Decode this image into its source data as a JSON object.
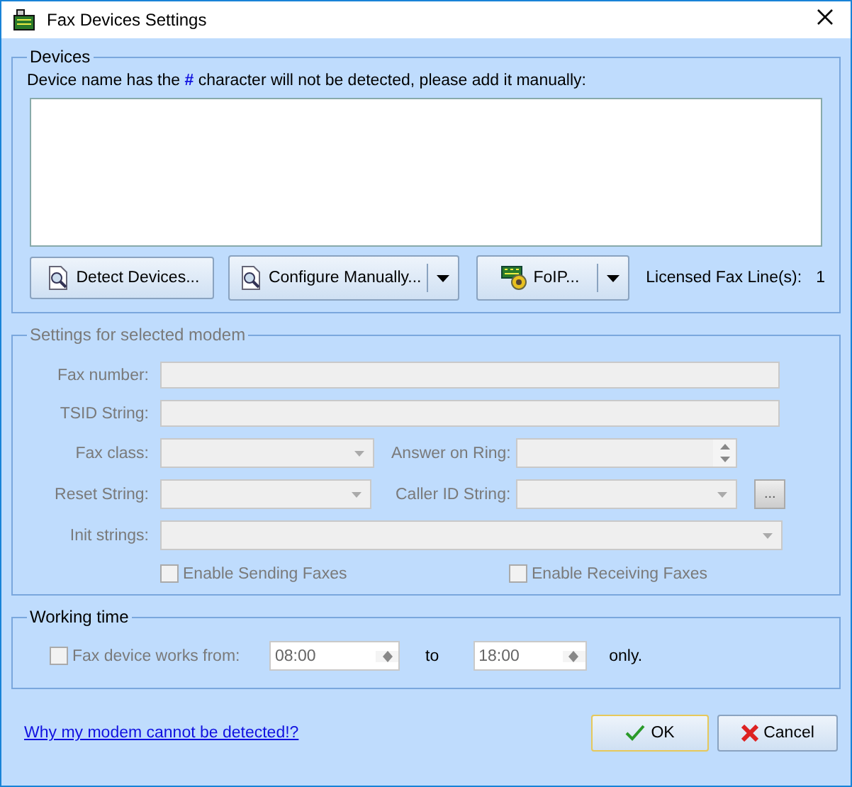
{
  "window": {
    "title": "Fax Devices Settings"
  },
  "devices": {
    "legend": "Devices",
    "note": "Device name has the **#** character will not be detected, please add it manually:",
    "buttons": [
      {
        "label": "Detect Devices...",
        "kind": "search",
        "dropdown": false
      },
      {
        "label": "Configure Manually...",
        "kind": "search",
        "dropdown": true
      },
      {
        "label": "FoIP...",
        "kind": "modem",
        "dropdown": true
      }
    ],
    "licensed_label": "Licensed Fax Line(s):",
    "licensed_value": "1"
  },
  "modem": {
    "legend": "Settings for selected modem",
    "disabled": true,
    "fax_number": "Fax number:",
    "tsid": "TSID String:",
    "fax_class": "Fax class:",
    "answer_on_ring": "Answer on Ring:",
    "reset_string": "Reset String:",
    "caller_id": "Caller ID String:",
    "more_button": "...",
    "init_strings": "Init strings:",
    "checkboxes": [
      {
        "label": "Enable Sending Faxes",
        "checked": false
      },
      {
        "label": "Enable Receiving Faxes",
        "checked": false
      }
    ]
  },
  "working_time": {
    "legend": "Working time",
    "checkbox": {
      "label": "Fax device works from:",
      "checked": false,
      "disabled": true
    },
    "from": "08:00",
    "to_label": "to",
    "to": "18:00",
    "suffix": "only."
  },
  "footer": {
    "link": "Why my modem cannot be detected!?",
    "ok": "OK",
    "cancel": "Cancel"
  }
}
